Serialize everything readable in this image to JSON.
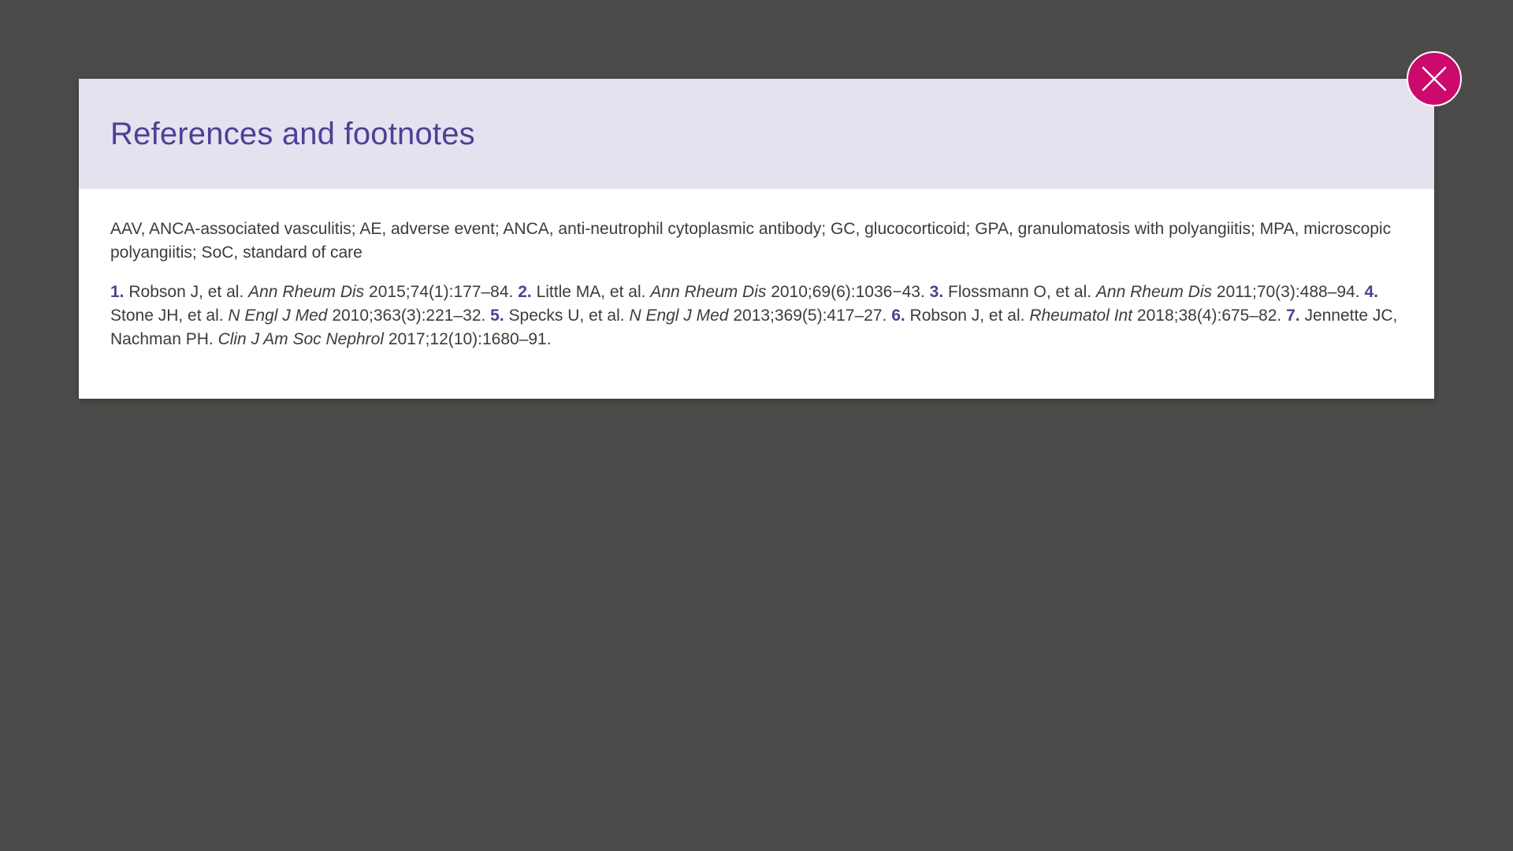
{
  "modal": {
    "title": "References and footnotes",
    "abbreviations": "AAV, ANCA-associated vasculitis; AE, adverse event; ANCA, anti-neutrophil cytoplasmic antibody; GC, glucocorticoid; GPA, granulomatosis with polyangiitis; MPA, microscopic polyangiitis; SoC, standard of care",
    "references": [
      {
        "num": "1.",
        "authors": "Robson J, et al.",
        "journal": "Ann Rheum Dis",
        "citation": "2015;74(1):177–84."
      },
      {
        "num": "2.",
        "authors": "Little MA, et al.",
        "journal": "Ann Rheum Dis",
        "citation": "2010;69(6):1036−43."
      },
      {
        "num": "3.",
        "authors": "Flossmann O, et al.",
        "journal": "Ann Rheum Dis",
        "citation": "2011;70(3):488–94."
      },
      {
        "num": "4.",
        "authors": "Stone JH, et al.",
        "journal": "N Engl J Med",
        "citation": "2010;363(3):221–32."
      },
      {
        "num": "5.",
        "authors": "Specks U, et al.",
        "journal": "N Engl J Med",
        "citation": "2013;369(5):417–27."
      },
      {
        "num": "6.",
        "authors": "Robson J, et al.",
        "journal": "Rheumatol Int",
        "citation": "2018;38(4):675–82."
      },
      {
        "num": "7.",
        "authors": "Jennette JC, Nachman PH.",
        "journal": "Clin J Am Soc Nephrol",
        "citation": "2017;12(10):1680–91."
      }
    ]
  },
  "close_button": {
    "icon": "close-icon"
  },
  "colors": {
    "backdrop": "#4b4b49",
    "header_bg": "#e4e2ef",
    "accent": "#4f3f96",
    "close_bg": "#cc0a6e"
  }
}
